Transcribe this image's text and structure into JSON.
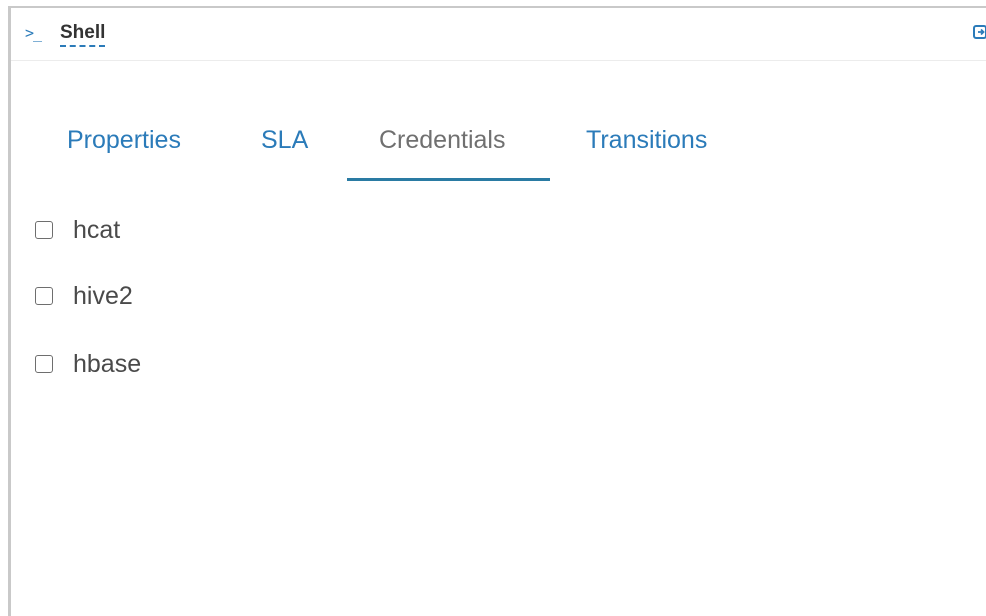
{
  "header": {
    "icon": "terminal-prompt-icon",
    "prompt_glyph": ">_",
    "title": "Shell",
    "expand_icon": "expand-icon"
  },
  "tabs": [
    {
      "label": "Properties",
      "active": false
    },
    {
      "label": "SLA",
      "active": false
    },
    {
      "label": "Credentials",
      "active": true
    },
    {
      "label": "Transitions",
      "active": false
    }
  ],
  "credentials": [
    {
      "label": "hcat",
      "checked": false
    },
    {
      "label": "hive2",
      "checked": false
    },
    {
      "label": "hbase",
      "checked": false
    }
  ],
  "colors": {
    "accent": "#2b7bb9",
    "active_tab_text": "#707070",
    "active_underline": "#2a7ba3",
    "text": "#4a4a4a",
    "border": "#c9c9c9"
  }
}
